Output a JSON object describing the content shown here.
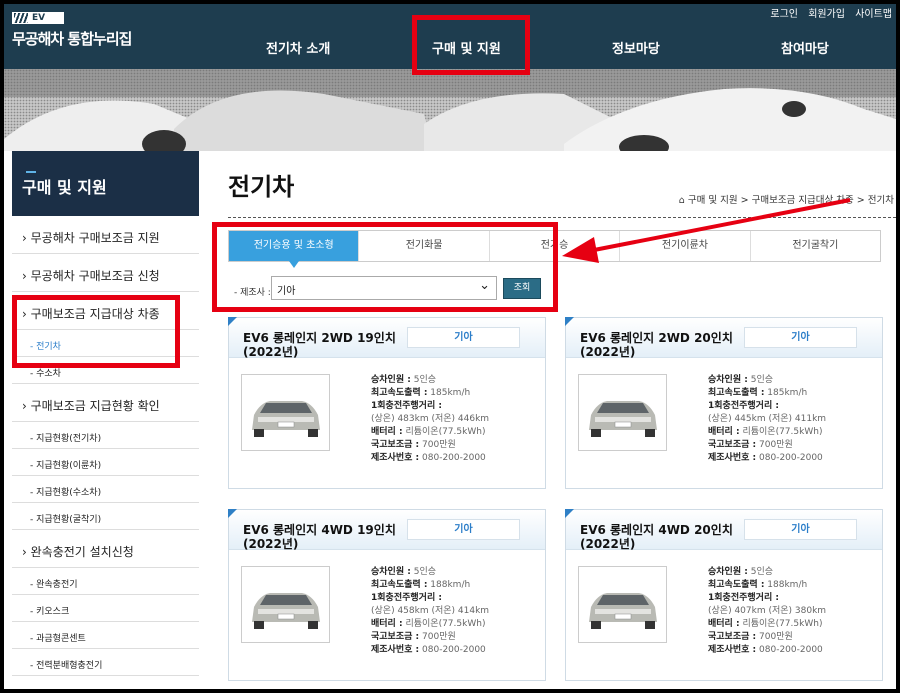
{
  "header": {
    "logo_badge": "EV",
    "logo_title": "무공해차 통합누리집",
    "util": [
      "로그인",
      "회원가입",
      "사이트맵"
    ],
    "nav": [
      "전기차 소개",
      "구매 및 지원",
      "정보마당",
      "참여마당"
    ]
  },
  "sidebar": {
    "title": "구매 및 지원",
    "items": [
      {
        "label": "› 무공해차 구매보조금 지원",
        "level": "main"
      },
      {
        "label": "› 무공해차 구매보조금 신청",
        "level": "main"
      },
      {
        "label": "› 구매보조금 지급대상 차종",
        "level": "main"
      },
      {
        "label": "- 전기차",
        "level": "sub",
        "active": true
      },
      {
        "label": "- 수소차",
        "level": "sub"
      },
      {
        "label": "› 구매보조금 지급현황 확인",
        "level": "main"
      },
      {
        "label": "- 지급현황(전기차)",
        "level": "sub"
      },
      {
        "label": "- 지급현황(이륜차)",
        "level": "sub"
      },
      {
        "label": "- 지급현황(수소차)",
        "level": "sub"
      },
      {
        "label": "- 지급현황(굴착기)",
        "level": "sub"
      },
      {
        "label": "› 완속충전기 설치신청",
        "level": "main"
      },
      {
        "label": "- 완속충전기",
        "level": "sub"
      },
      {
        "label": "- 키오스크",
        "level": "sub"
      },
      {
        "label": "- 과금형콘센트",
        "level": "sub"
      },
      {
        "label": "- 전력분배형충전기",
        "level": "sub"
      }
    ]
  },
  "content": {
    "title": "전기차",
    "breadcrumb": "구매 및 지원 > 구매보조금 지급대상 차종 > 전기차",
    "tabs": [
      "전기승용 및 초소형",
      "전기화물",
      "전기승",
      "전기이륜차",
      "전기굴착기"
    ],
    "filter": {
      "label": "- 제조사 :",
      "value": "기아",
      "button": "조회"
    }
  },
  "cards": [
    {
      "title1": "EV6 롱레인지 2WD 19인치",
      "title2": "(2022년)",
      "maker": "기아",
      "seats": "5인승",
      "speed": "185km/h",
      "range": "(상온) 483km (저온) 446km",
      "battery": "리튬이온(77.5kWh)",
      "subsidy": "700만원",
      "phone": "080-200-2000"
    },
    {
      "title1": "EV6 롱레인지 2WD 20인치",
      "title2": "(2022년)",
      "maker": "기아",
      "seats": "5인승",
      "speed": "185km/h",
      "range": "(상온) 445km (저온) 411km",
      "battery": "리튬이온(77.5kWh)",
      "subsidy": "700만원",
      "phone": "080-200-2000"
    },
    {
      "title1": "EV6 롱레인지 4WD 19인치",
      "title2": "(2022년)",
      "maker": "기아",
      "seats": "5인승",
      "speed": "188km/h",
      "range": "(상온) 458km (저온) 414km",
      "battery": "리튬이온(77.5kWh)",
      "subsidy": "700만원",
      "phone": "080-200-2000"
    },
    {
      "title1": "EV6 롱레인지 4WD 20인치",
      "title2": "(2022년)",
      "maker": "기아",
      "seats": "5인승",
      "speed": "188km/h",
      "range": "(상온) 407km (저온) 380km",
      "battery": "리튬이온(77.5kWh)",
      "subsidy": "700만원",
      "phone": "080-200-2000"
    }
  ],
  "spec_labels": {
    "seats": "승차인원 :",
    "speed": "최고속도출력 :",
    "range": "1회충전주행거리 :",
    "battery": "배터리 :",
    "subsidy": "국고보조금 :",
    "phone": "제조사번호 :"
  },
  "colors": {
    "header": "#1e3d4f",
    "accent": "#38a0de",
    "highlight": "#e60012"
  }
}
